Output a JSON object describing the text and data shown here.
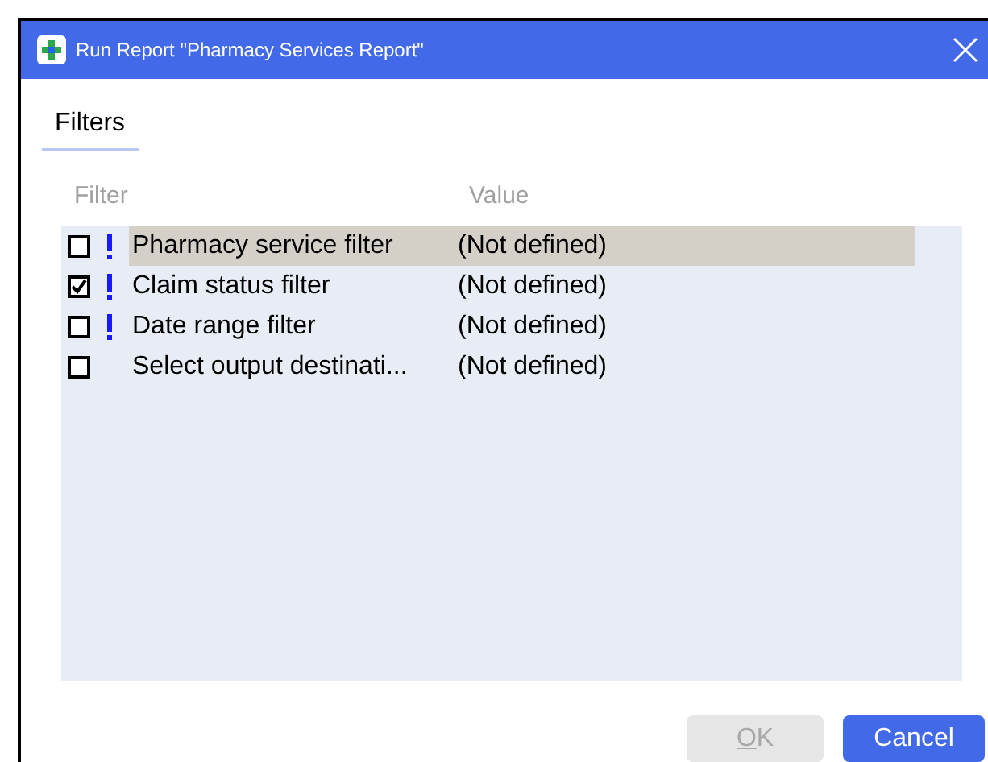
{
  "window": {
    "title": "Run Report \"Pharmacy Services Report\""
  },
  "tabs": [
    {
      "label": "Filters",
      "selected": true
    }
  ],
  "table": {
    "columns": [
      "Filter",
      "Value"
    ],
    "rows": [
      {
        "checked": false,
        "required": true,
        "selected": true,
        "filter": "Pharmacy service filter",
        "value": "(Not defined)"
      },
      {
        "checked": true,
        "required": true,
        "selected": false,
        "filter": "Claim status filter",
        "value": "(Not defined)"
      },
      {
        "checked": false,
        "required": true,
        "selected": false,
        "filter": "Date range filter",
        "value": "(Not defined)"
      },
      {
        "checked": false,
        "required": false,
        "selected": false,
        "filter": "Select output destinati...",
        "value": "(Not defined)"
      }
    ]
  },
  "buttons": [
    {
      "label": "OK",
      "disabled": true
    },
    {
      "label": "Cancel",
      "disabled": false
    }
  ]
}
